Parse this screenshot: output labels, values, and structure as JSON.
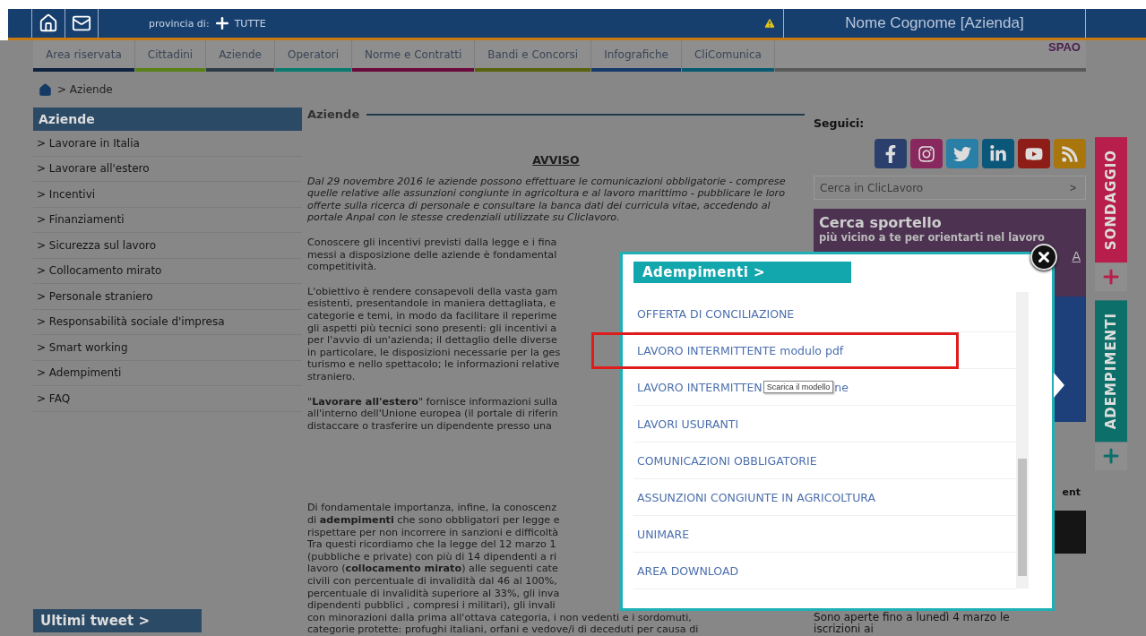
{
  "top_bar": {
    "province_label": "provincia di:",
    "province_value": "TUTTE",
    "user": "Nome Cognome [Azienda]"
  },
  "nav": {
    "tabs": [
      {
        "label": "Area riservata",
        "color": "#0f2340"
      },
      {
        "label": "Cittadini",
        "color": "#5a8018"
      },
      {
        "label": "Aziende",
        "color": "#2f3c48"
      },
      {
        "label": "Operatori",
        "color": "#0b7a6e"
      },
      {
        "label": "Norme e Contratti",
        "color": "#6a0a3a"
      },
      {
        "label": "Bandi e Concorsi",
        "color": "#59620c"
      },
      {
        "label": "Infografiche",
        "color": "#163a6c"
      },
      {
        "label": "CliComunica",
        "color": "#075a70"
      }
    ],
    "logo": "SPAO"
  },
  "breadcrumb": {
    "current": "> Aziende"
  },
  "sidebar": {
    "title": "Aziende",
    "items": [
      "> Lavorare in Italia",
      "> Lavorare all'estero",
      "> Incentivi",
      "> Finanziamenti",
      "> Sicurezza sul lavoro",
      "> Collocamento mirato",
      "> Personale straniero",
      "> Responsabilità sociale d'impresa",
      "> Smart working",
      "> Adempimenti",
      "> FAQ"
    ],
    "tweets_title": "Ultimi tweet >"
  },
  "content": {
    "title": "Aziende",
    "notice_title": "AVVISO",
    "notice": "Dal 29 novembre 2016 le aziende possono effettuare le comunicazioni obbligatorie - comprese quelle relative alle assunzioni congiunte in agricoltura e al lavoro marittimo - pubblicare le loro offerte sulla ricerca di personale e consultare la banca dati dei curricula vitae, accedendo al portale Anpal con le stesse credenziali utilizzate su Cliclavoro.",
    "paragraphs": [
      {
        "lines": [
          "Conoscere gli incentivi previsti dalla legge e i fina",
          "messi a disposizione delle aziende è fondamental",
          "competitività."
        ]
      },
      {
        "lines": [
          "L'obiettivo è rendere consapevoli della vasta gam",
          "esistenti, presentandole in maniera dettagliata, e",
          "categorie e temi, in modo da facilitare il reperime",
          "gli aspetti più tecnici sono presenti: gli incentivi a",
          "per l'avvio di un'azienda; il dettaglio delle diverse",
          "in particolare, le disposizioni necessarie per la ges",
          "turismo e nello spettacolo; le informazioni relative",
          "straniero."
        ]
      },
      {
        "lines": [
          "\"**Lavorare all'estero**\" fornisce informazioni sulla",
          "all'interno dell'Unione europea (il portale di riferin",
          "distaccare o trasferire un dipendente presso una"
        ]
      },
      {
        "lines": [
          "Di fondamentale importanza, infine, la conoscenz",
          "di **adempimenti** che sono obbligatori per legge e",
          "rispettare per non incorrere in sanzioni e difficoltà",
          "Tra questi ricordiamo che la legge del 12 marzo 1",
          "(pubbliche e private) con più di 14 dipendenti a ri",
          "lavoro (**collocamento mirato**) alle seguenti cate",
          "civili con percentuale di invalidità dal 46 al 100%,",
          "percentuale di invalidità superiore al 33%, gli inva",
          "dipendenti pubblici , compresi i militari), gli invali",
          "con minorazioni dalla prima all'ottava categoria, i non vedenti e i sordomuti,",
          "categorie protette: profughi italiani, orfani e vedove/i di deceduti per causa di"
        ]
      }
    ]
  },
  "right": {
    "follow_label": "Seguici:",
    "search_placeholder": "Cerca in ClicLavoro",
    "search_button": ">",
    "promo": {
      "title": "Cerca sportello",
      "subtitle": "più vicino a te per orientarti nel lavoro",
      "link_fragment": "A"
    },
    "fragment": "ent",
    "news_lines": [
      "Sono aperte fino a lunedì 4 marzo le",
      "iscrizioni ai"
    ]
  },
  "side_tabs": [
    {
      "label": "SONDAGGIO",
      "color": "#b81e4b"
    },
    {
      "label": "ADEMPIMENTI",
      "color": "#0d6f69"
    }
  ],
  "modal": {
    "title": "Adempimenti >",
    "items": [
      {
        "label": "OFFERTA DI CONCILIAZIONE",
        "highlighted": false
      },
      {
        "label": "LAVORO INTERMITTENTE modulo pdf",
        "highlighted": true
      },
      {
        "label": "LAVORO INTERMITTEN",
        "tooltip": "Scarica il modello",
        "label_end": "ne",
        "highlighted": false
      },
      {
        "label": "LAVORI USURANTI",
        "highlighted": false
      },
      {
        "label": "COMUNICAZIONI OBBLIGATORIE",
        "highlighted": false
      },
      {
        "label": "ASSUNZIONI CONGIUNTE IN AGRICOLTURA",
        "highlighted": false
      },
      {
        "label": "UNIMARE",
        "highlighted": false
      },
      {
        "label": "AREA DOWNLOAD",
        "highlighted": false
      }
    ]
  }
}
